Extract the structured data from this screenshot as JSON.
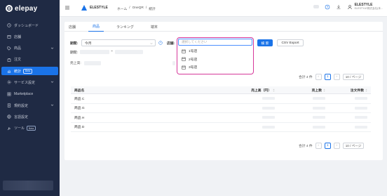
{
  "app": {
    "brand": "elepay"
  },
  "sidebar": {
    "items": [
      {
        "label": "ダッシュボード",
        "icon": "clock-icon"
      },
      {
        "label": "店舗",
        "icon": "store-icon"
      },
      {
        "label": "商品",
        "icon": "tag-icon",
        "expandable": true
      },
      {
        "label": "注文",
        "icon": "bag-icon"
      },
      {
        "label": "統計",
        "icon": "chart-icon",
        "badge": "Beta",
        "active": true
      },
      {
        "label": "サービス設定",
        "icon": "gear-icon",
        "expandable": true
      },
      {
        "label": "Marketplace",
        "icon": "grid-icon"
      },
      {
        "label": "規約設定",
        "icon": "doc-icon",
        "expandable": true
      },
      {
        "label": "言語設定",
        "icon": "globe-icon"
      },
      {
        "label": "ツール",
        "icon": "wrench-icon",
        "badge": "Beta"
      }
    ]
  },
  "header": {
    "org_name": "ELESTYLE",
    "breadcrumb": [
      "ホーム",
      "/",
      "OneQR",
      "/",
      "統計"
    ],
    "user_name": "ELESTYLE",
    "user_sub": "ELESTYLE株式会社(本..."
  },
  "tabs": [
    {
      "label": "店舗",
      "active": false
    },
    {
      "label": "商品",
      "active": true
    },
    {
      "label": "ランキング",
      "active": false
    },
    {
      "label": "端末",
      "active": false
    }
  ],
  "filters": {
    "period_label": "期間:",
    "period_value": "今月",
    "period_range_label": "期間:",
    "range_sep": "~",
    "sales_label": "売上高:",
    "store_label": "店舗:",
    "store_placeholder": "選択してください",
    "search_button": "検 索",
    "csv_button": "CSV Export"
  },
  "store_dropdown": {
    "options": [
      "1号店",
      "2号店",
      "3号店"
    ]
  },
  "pagination_top": {
    "total": "合計 4 件",
    "page": "1",
    "page_size": "10 / ページ"
  },
  "pagination_bottom": {
    "total": "合計 4 件",
    "page": "1",
    "page_size": "10 / ページ"
  },
  "table": {
    "headers": {
      "name": "商品名",
      "sales": "売上高（円）",
      "qty": "売上数",
      "orders": "注文件数"
    },
    "rows": [
      {
        "name": "商品 C"
      },
      {
        "name": "商品 G"
      },
      {
        "name": "商品 H"
      },
      {
        "name": "商品 D"
      }
    ]
  },
  "colors": {
    "sidebar_bg": "#1f2a44",
    "accent": "#1a73e8",
    "highlight": "#d6389a"
  }
}
